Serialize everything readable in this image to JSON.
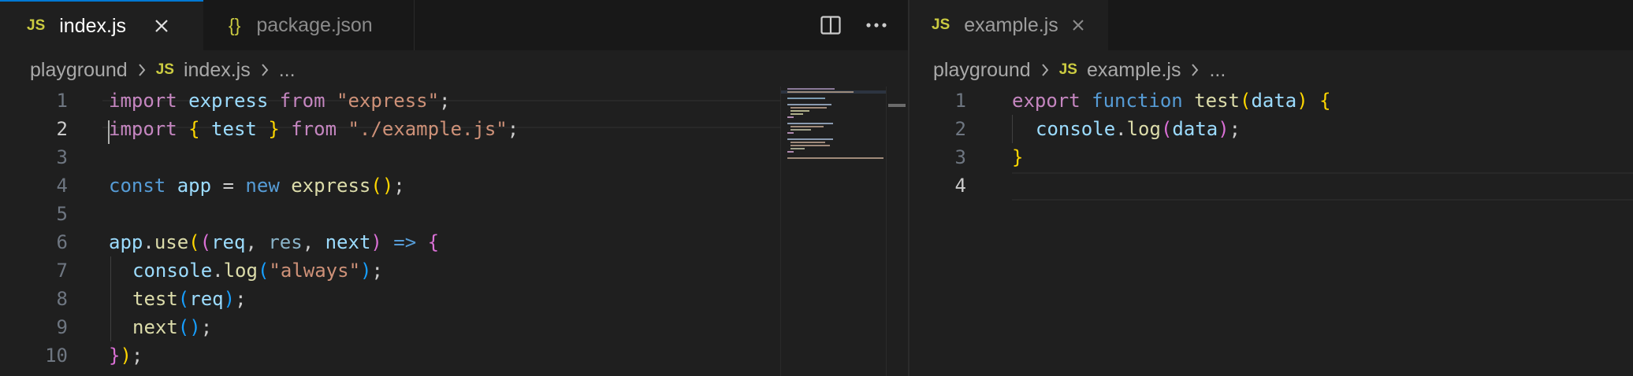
{
  "left": {
    "tabs": [
      {
        "icon": "JS",
        "label": "index.js"
      },
      {
        "icon": "{}",
        "label": "package.json"
      }
    ],
    "breadcrumb": {
      "folder": "playground",
      "icon": "JS",
      "file": "index.js",
      "more": "..."
    },
    "line_numbers": [
      "1",
      "2",
      "3",
      "4",
      "5",
      "6",
      "7",
      "8",
      "9",
      "10"
    ],
    "code": {
      "l1": {
        "a": "import",
        "b": " express ",
        "c": "from",
        "d": " ",
        "e": "\"express\"",
        "f": ";"
      },
      "l2": {
        "a": "import",
        "b": " ",
        "c": "{",
        "d": " test ",
        "e": "}",
        "f": " from ",
        "g": "\"./example.js\"",
        "h": ";"
      },
      "l4": {
        "a": "const",
        "b": " ",
        "c": "app",
        "d": " = ",
        "e": "new",
        "f": " ",
        "g": "express",
        "h": "(",
        "i": ")",
        "j": ";"
      },
      "l6": {
        "a": "app",
        "b": ".",
        "c": "use",
        "d": "(",
        "e": "(",
        "f": "req",
        "g": ", ",
        "h": "res",
        "i": ", ",
        "j": "next",
        "k": ")",
        "l": " => ",
        "m": "{"
      },
      "l7": {
        "a": "console",
        "b": ".",
        "c": "log",
        "d": "(",
        "e": "\"always\"",
        "f": ")",
        "g": ";"
      },
      "l8": {
        "a": "test",
        "b": "(",
        "c": "req",
        "d": ")",
        "e": ";"
      },
      "l9": {
        "a": "next",
        "b": "(",
        "c": ")",
        "d": ";"
      },
      "l10": {
        "a": "}",
        "b": ")",
        "c": ";"
      }
    }
  },
  "right": {
    "tab": {
      "icon": "JS",
      "label": "example.js"
    },
    "breadcrumb": {
      "folder": "playground",
      "icon": "JS",
      "file": "example.js",
      "more": "..."
    },
    "line_numbers": [
      "1",
      "2",
      "3",
      "4"
    ],
    "code": {
      "l1": {
        "a": "export",
        "b": " ",
        "c": "function",
        "d": " ",
        "e": "test",
        "f": "(",
        "g": "data",
        "h": ")",
        "i": " ",
        "j": "{"
      },
      "l2": {
        "a": "console",
        "b": ".",
        "c": "log",
        "d": "(",
        "e": "data",
        "f": ")",
        "g": ";"
      },
      "l3": {
        "a": "}"
      }
    }
  },
  "icons": {
    "tab_close": "close-icon",
    "split_editor": "split-editor-icon",
    "more_actions": "ellipsis-icon",
    "breadcrumb_separator": "chevron-right-icon"
  },
  "colors": {
    "background": "#1f1f1f",
    "tab_bar": "#181818",
    "active_tab_border": "#0078d4",
    "js_icon": "#cbcb41",
    "keyword_control": "#c586c0",
    "keyword": "#569cd6",
    "string": "#ce9178",
    "variable": "#9cdcfe",
    "function": "#dcdcaa",
    "bracket_level1": "#ffd700",
    "bracket_level2": "#da70d6",
    "bracket_level3": "#179fff"
  }
}
